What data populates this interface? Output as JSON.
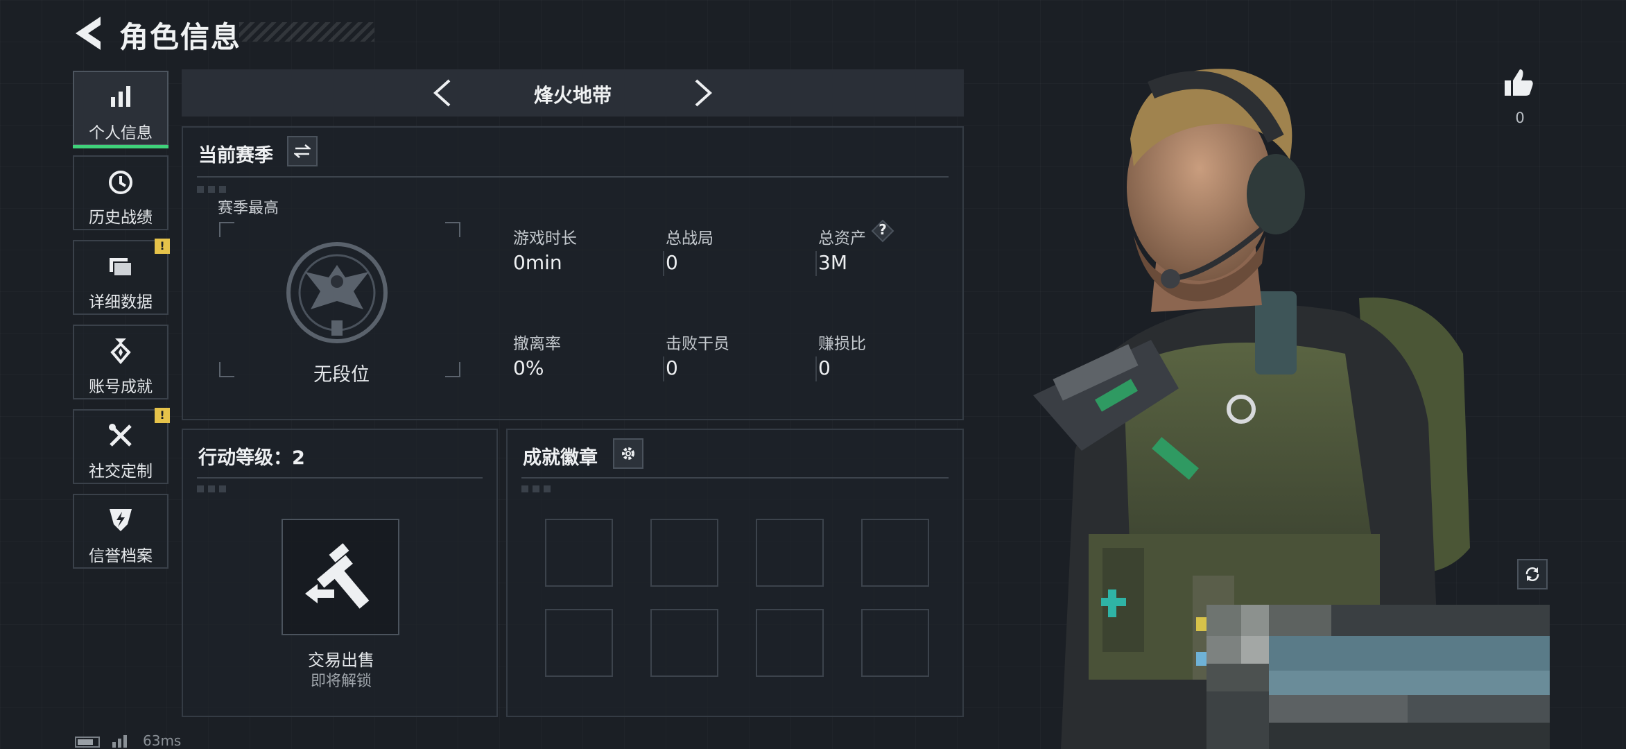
{
  "header": {
    "title": "角色信息"
  },
  "nav": [
    {
      "label": "个人信息",
      "icon": "bar-chart-icon",
      "active": true,
      "badge": ""
    },
    {
      "label": "历史战绩",
      "icon": "clock-history-icon",
      "active": false,
      "badge": ""
    },
    {
      "label": "详细数据",
      "icon": "folder-icon",
      "active": false,
      "badge": "!"
    },
    {
      "label": "账号成就",
      "icon": "medal-icon",
      "active": false,
      "badge": ""
    },
    {
      "label": "社交定制",
      "icon": "tools-icon",
      "active": false,
      "badge": "!"
    },
    {
      "label": "信誉档案",
      "icon": "shield-bolt-icon",
      "active": false,
      "badge": ""
    }
  ],
  "mode": {
    "name": "烽火地带"
  },
  "season": {
    "title": "当前赛季",
    "best_label": "赛季最高",
    "rank_name": "无段位",
    "stats": [
      {
        "label": "游戏时长",
        "value": "0min"
      },
      {
        "label": "总战局",
        "value": "0"
      },
      {
        "label": "总资产",
        "value": "3M",
        "help": "?"
      },
      {
        "label": "撤离率",
        "value": "0%"
      },
      {
        "label": "击败干员",
        "value": "0"
      },
      {
        "label": "赚损比",
        "value": "0"
      }
    ]
  },
  "action_level": {
    "title": "行动等级：2",
    "feature": "交易出售",
    "status": "即将解锁"
  },
  "badges": {
    "title": "成就徽章",
    "slots": 8
  },
  "likes": {
    "count": "0"
  },
  "status_bar": {
    "ping": "63ms"
  },
  "colors": {
    "accent": "#3fd27a",
    "badge": "#e6c34a",
    "background": "#1b1f25"
  }
}
